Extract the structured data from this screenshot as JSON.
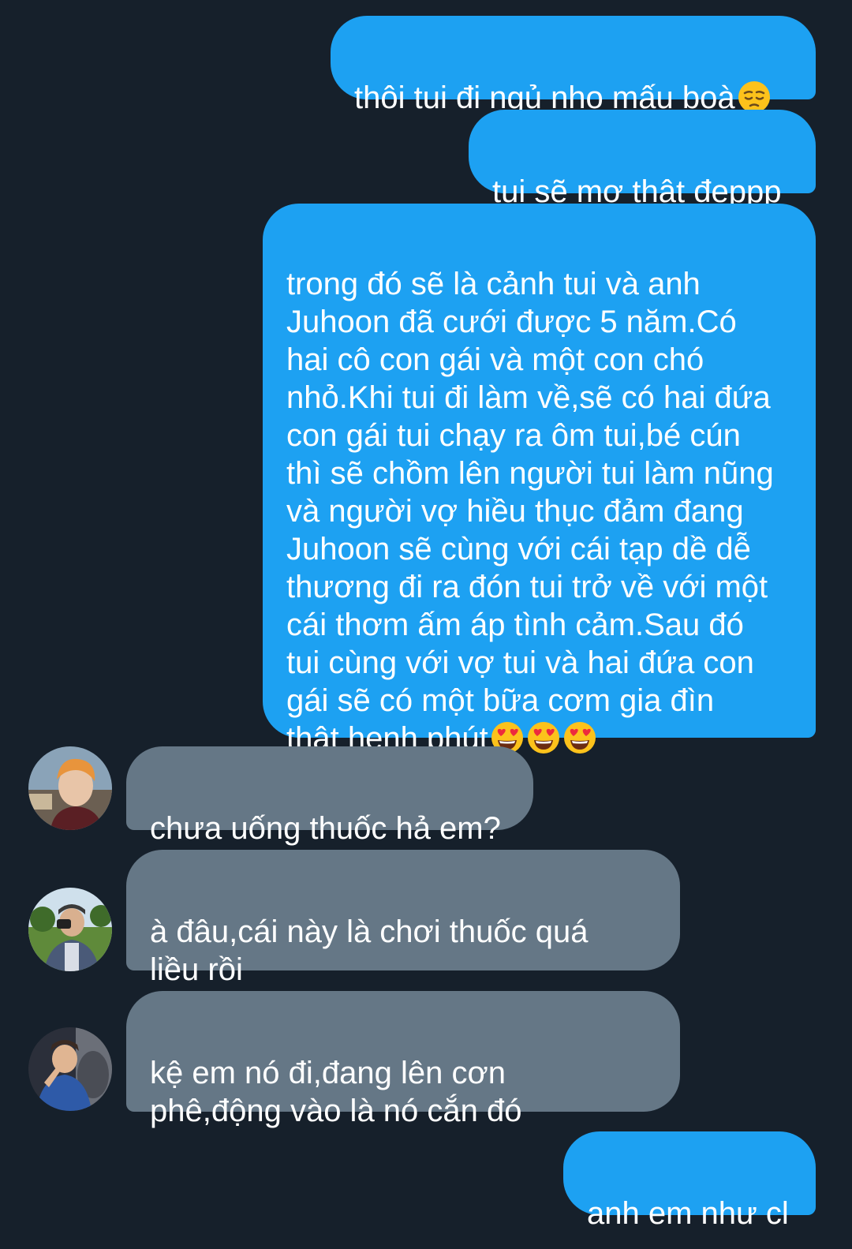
{
  "theme": {
    "background": "#16202b",
    "sent_bubble": "#1da1f2",
    "received_bubble": "#657786",
    "text": "#ffffff"
  },
  "messages": [
    {
      "direction": "sent",
      "text": "thôi tui đi ngủ nho mấu boà",
      "emoji": "pensive-face"
    },
    {
      "direction": "sent",
      "text": "tui sẽ mơ thật đẹppp"
    },
    {
      "direction": "sent",
      "text": "trong đó sẽ là cảnh tui và anh\nJuhoon đã cưới được 5 năm.Có\nhai cô con gái và một con chó\nnhỏ.Khi tui đi làm về,sẽ có hai đứa\ncon gái tui chạy ra ôm tui,bé cún\nthì sẽ chồm lên người tui làm nũng\nvà người vợ hiều thục đảm đang\nJuhoon sẽ cùng với cái tạp dề dễ\nthương đi ra đón tui trở về với một\ncái thơm ấm áp tình cảm.Sau đó\ntui cùng với vợ tui và hai đứa con\ngái sẽ có một bữa cơm gia đìn\nthật hẹnh phút",
      "emoji": "heart-eyes-face x3"
    },
    {
      "direction": "received",
      "text": "chưa uống thuốc hả em?",
      "avatar": "avatar-orange-hair"
    },
    {
      "direction": "received",
      "text": "à đâu,cái này là chơi thuốc quá\nliều rồi",
      "avatar": "avatar-camera"
    },
    {
      "direction": "received",
      "text": "kệ em nó đi,đang lên cơn\nphê,động vào là nó cắn đó",
      "avatar": "avatar-car"
    },
    {
      "direction": "sent",
      "text": "anh em như cl"
    }
  ]
}
